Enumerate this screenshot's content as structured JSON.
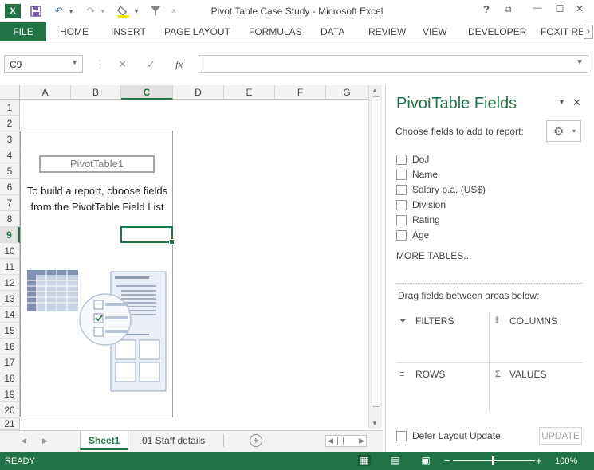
{
  "window": {
    "title": "Pivot Table Case Study - Microsoft Excel",
    "help": "?",
    "restore": "⧉",
    "minimize": "—",
    "maximize": "☐",
    "close": "✕"
  },
  "quick_access": {
    "excel_logo": "X",
    "save": "💾",
    "undo": "↶",
    "undo_dd": "▾",
    "redo": "↷",
    "redo_dd": "▾",
    "fill": "🖌",
    "fill_dd": "▾",
    "filter": "⏷",
    "customize": "⩡"
  },
  "ribbon": {
    "file": "FILE",
    "tabs": [
      "HOME",
      "INSERT",
      "PAGE LAYOUT",
      "FORMULAS",
      "DATA",
      "REVIEW",
      "VIEW",
      "DEVELOPER",
      "FOXIT REA"
    ],
    "scroll_right": "›"
  },
  "formula_bar": {
    "name_box": "C9",
    "cancel": "✕",
    "enter": "✓",
    "fx": "fx",
    "value": ""
  },
  "grid": {
    "columns": [
      "A",
      "B",
      "C",
      "D",
      "E",
      "F",
      "G"
    ],
    "selected_column": "C",
    "rows": [
      "1",
      "2",
      "3",
      "4",
      "5",
      "6",
      "7",
      "8",
      "9",
      "10",
      "11",
      "12",
      "13",
      "14",
      "15",
      "16",
      "17",
      "18",
      "19",
      "20",
      "21"
    ],
    "selected_row": "9"
  },
  "pivot_placeholder": {
    "name": "PivotTable1",
    "message": "To build a report, choose fields from the PivotTable Field List"
  },
  "sheets": {
    "tabs": [
      "Sheet1",
      "01 Staff details"
    ],
    "active": "Sheet1",
    "prev": "◀",
    "next": "▶",
    "add": "+"
  },
  "pivot_pane": {
    "title": "PivotTable Fields",
    "dropdown": "▾",
    "close": "✕",
    "subtitle": "Choose fields to add to report:",
    "gear": "⚙",
    "gear_dd": "▾",
    "fields": [
      "DoJ",
      "Name",
      "Salary p.a. (US$)",
      "Division",
      "Rating",
      "Age"
    ],
    "more_tables": "MORE TABLES...",
    "drag_note": "Drag fields between areas below:",
    "areas": {
      "filters": "FILTERS",
      "columns": "COLUMNS",
      "rows": "ROWS",
      "values": "VALUES"
    },
    "area_icons": {
      "filters": "⏷",
      "columns": "⦀",
      "rows": "≡",
      "values": "Σ"
    },
    "defer_label": "Defer Layout Update",
    "update_label": "UPDATE"
  },
  "status_bar": {
    "ready": "READY",
    "zoom_minus": "−",
    "zoom_plus": "+",
    "zoom": "100%",
    "view_normal": "▦",
    "view_page_layout": "▤",
    "view_page_break": "▣"
  },
  "colors": {
    "accent": "#217346",
    "status_bar": "#217346"
  }
}
